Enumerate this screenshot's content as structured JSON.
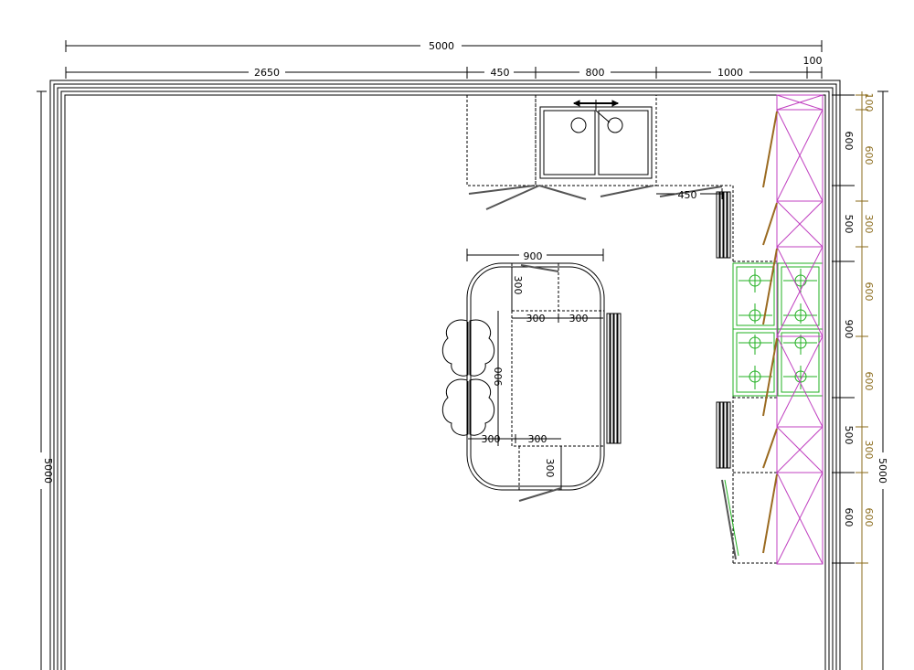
{
  "plan": {
    "dimensions": {
      "top_overall": "5000",
      "top_segments": [
        "2650",
        "450",
        "800",
        "1000",
        "100"
      ],
      "left_overall": "5000",
      "right_overall": "5000",
      "right_brown": [
        "100",
        "600",
        "300",
        "600",
        "600",
        "300",
        "600"
      ],
      "right_black": [
        "600",
        "500",
        "900",
        "500",
        "600"
      ],
      "sink_gap": "450",
      "island_width": "900",
      "island_depth": "900",
      "island_offsets": [
        "300",
        "300",
        "300",
        "300",
        "300",
        "300"
      ]
    },
    "colors": {
      "walls": "#000000",
      "tall_units": "#c040c0",
      "hob": "#22b022",
      "dim_brown": "#8a6a1a",
      "doors": "#9a6a20"
    }
  }
}
